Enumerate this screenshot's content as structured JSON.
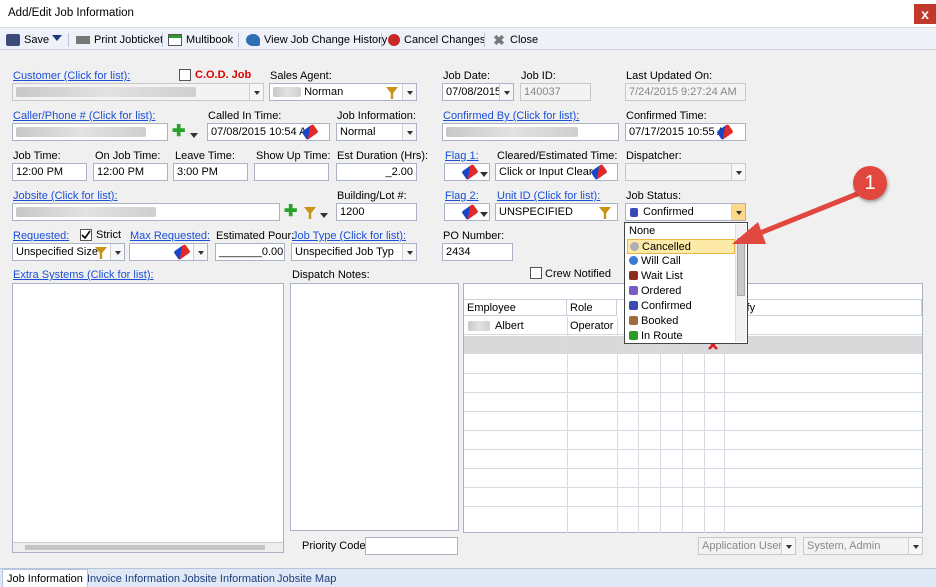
{
  "window": {
    "title": "Add/Edit Job Information",
    "close": "x"
  },
  "toolbar": {
    "save": "Save",
    "print": "Print Jobticket",
    "multibook": "Multibook",
    "history": "View Job Change History",
    "cancel": "Cancel Changes",
    "close": "Close"
  },
  "customer": {
    "label": "Customer (Click for list):",
    "cod": "C.O.D. Job"
  },
  "sales_agent": {
    "label": "Sales Agent:",
    "value": "Norman"
  },
  "job_date": {
    "label": "Job Date:",
    "value": "07/08/2015"
  },
  "job_id": {
    "label": "Job ID:",
    "value": "140037"
  },
  "last_updated": {
    "label": "Last Updated On:",
    "value": "7/24/2015 9:27:24 AM"
  },
  "caller": {
    "label": "Caller/Phone # (Click for list):"
  },
  "called_in": {
    "label": "Called In Time:",
    "value": "07/08/2015 10:54 A"
  },
  "job_info": {
    "label": "Job Information:",
    "value": "Normal"
  },
  "confirmed_by": {
    "label": "Confirmed By (Click for list):"
  },
  "confirmed_time": {
    "label": "Confirmed Time:",
    "value": "07/17/2015 10:55 A"
  },
  "job_time": {
    "label": "Job Time:",
    "value": "12:00 PM"
  },
  "on_job_time": {
    "label": "On Job Time:",
    "value": "12:00 PM"
  },
  "leave_time": {
    "label": "Leave Time:",
    "value": "3:00 PM"
  },
  "show_up_time": {
    "label": "Show Up Time:",
    "value": ""
  },
  "est_duration": {
    "label": "Est Duration (Hrs):",
    "value": "_2.00"
  },
  "flag1": {
    "label": "Flag 1:"
  },
  "cleared": {
    "label": "Cleared/Estimated Time:",
    "value": "Click or Input Cleare"
  },
  "dispatcher": {
    "label": "Dispatcher:",
    "value": ""
  },
  "jobsite": {
    "label": "Jobsite (Click for list):"
  },
  "building": {
    "label": "Building/Lot #:",
    "value": "1200"
  },
  "flag2": {
    "label": "Flag 2:"
  },
  "unit_id": {
    "label": "Unit ID (Click for list):",
    "value": "UNSPECIFIED"
  },
  "job_status": {
    "label": "Job Status:",
    "value": "Confirmed"
  },
  "requested": {
    "label": "Requested:",
    "strict": "Strict",
    "value": "Unspecified Size"
  },
  "max_requested": {
    "label": "Max Requested:",
    "value": ""
  },
  "estimated_pour": {
    "label": "Estimated Pour:",
    "value": "_______0.00"
  },
  "job_type": {
    "label": "Job Type (Click for list):",
    "value": "Unspecified Job Typ"
  },
  "po_number": {
    "label": "PO Number:",
    "value": "2434"
  },
  "extra_systems": {
    "label": "Extra Systems (Click for list):"
  },
  "dispatch_notes": {
    "label": "Dispatch Notes:"
  },
  "crew_notified": {
    "label": "Crew Notified"
  },
  "crew_grid": {
    "headers": [
      "Employee",
      "Role",
      "Notify"
    ],
    "rows": [
      {
        "employee": "Albert",
        "role": "Operator"
      }
    ]
  },
  "priority": {
    "label": "Priority Code:",
    "value": ""
  },
  "footer": {
    "app_user": "Application User",
    "system_admin": "System, Admin"
  },
  "status_options": [
    {
      "label": "None",
      "color": ""
    },
    {
      "label": "Cancelled",
      "color": "#b0b0b0"
    },
    {
      "label": "Will Call",
      "color": "#3a7bd5"
    },
    {
      "label": "Wait List",
      "color": "#8b2e1a"
    },
    {
      "label": "Ordered",
      "color": "#7a5cc7"
    },
    {
      "label": "Confirmed",
      "color": "#3a4ab5"
    },
    {
      "label": "Booked",
      "color": "#a06a3a"
    },
    {
      "label": "In Route",
      "color": "#2a9a2a"
    }
  ],
  "callout": {
    "number": "1"
  },
  "tabs": [
    "Job Information",
    "Invoice Information",
    "Jobsite Information",
    "Jobsite Map"
  ],
  "colors": {
    "link": "#1a4fd6",
    "callout": "#e2473f",
    "selection": "#fde9a8"
  }
}
